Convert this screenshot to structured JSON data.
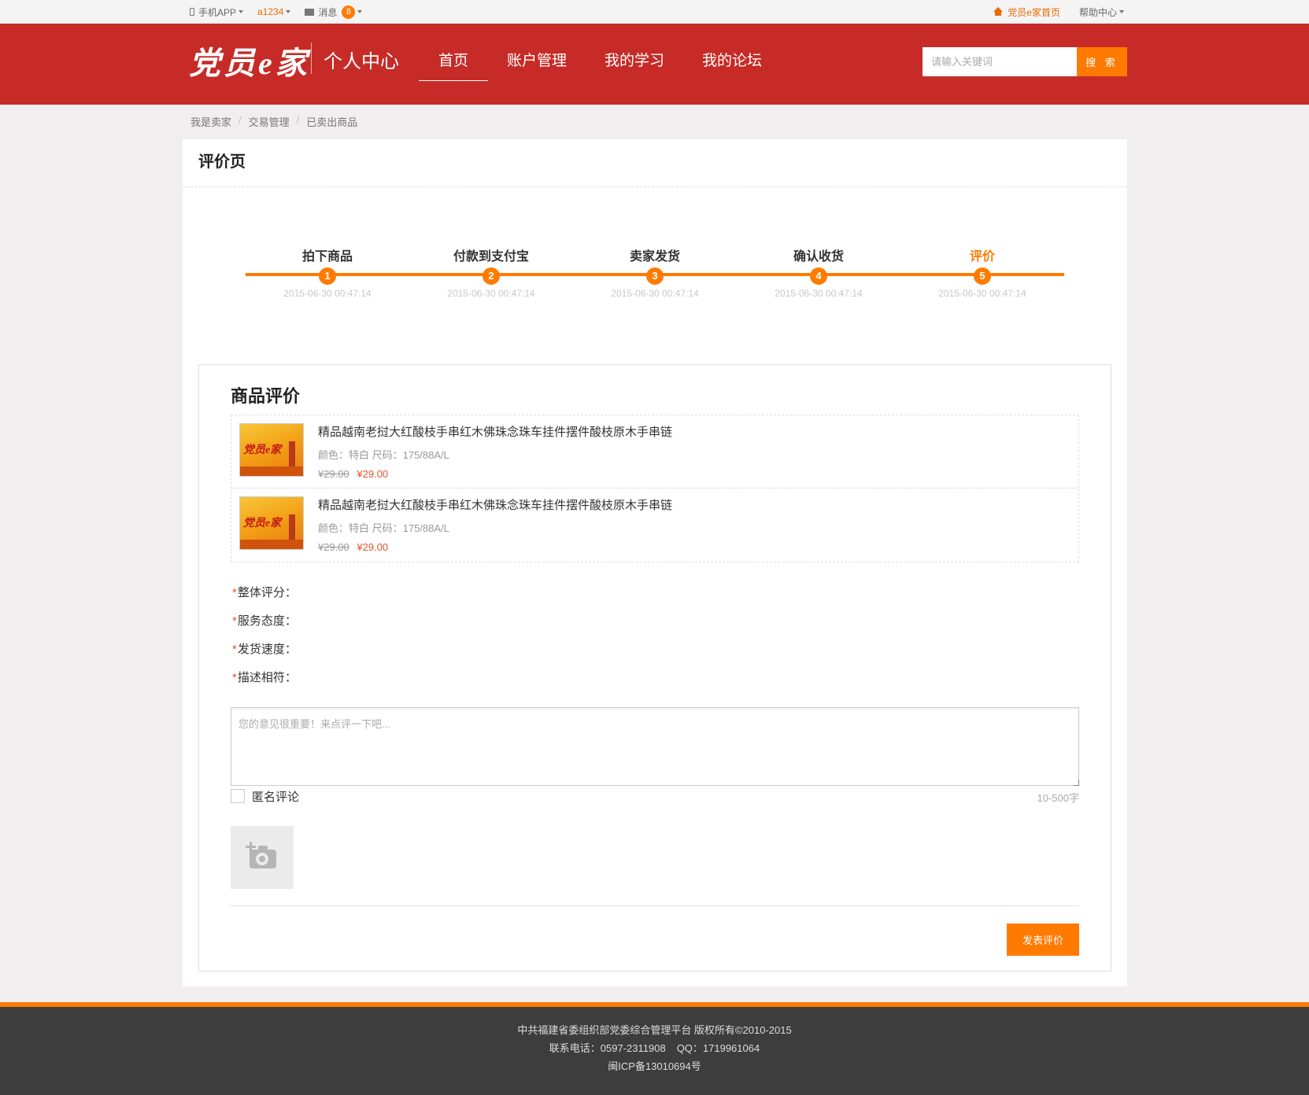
{
  "topbar": {
    "app_label": "手机APP",
    "username": "a1234",
    "messages_label": "消息",
    "messages_count": "8",
    "home_link": "党员e家首页",
    "help_label": "帮助中心"
  },
  "header": {
    "logo_text": "党员e家",
    "logo_sub": "个人中心",
    "nav": [
      "首页",
      "账户管理",
      "我的学习",
      "我的论坛"
    ],
    "search_placeholder": "请输入关键词",
    "search_button": "搜 索"
  },
  "breadcrumb": [
    "我是卖家",
    "交易管理",
    "已卖出商品"
  ],
  "page_title": "评价页",
  "steps": [
    {
      "label": "拍下商品",
      "num": "1",
      "time": "2015-06-30 00:47:14"
    },
    {
      "label": "付款到支付宝",
      "num": "2",
      "time": "2015-06-30 00:47:14"
    },
    {
      "label": "卖家发货",
      "num": "3",
      "time": "2015-06-30 00:47:14"
    },
    {
      "label": "确认收货",
      "num": "4",
      "time": "2015-06-30 00:47:14"
    },
    {
      "label": "评价",
      "num": "5",
      "time": "2015-06-30 00:47:14"
    }
  ],
  "eval": {
    "title": "商品评价",
    "goods": [
      {
        "thumb_text": "党员e家",
        "name": "精品越南老挝大红酸枝手串红木佛珠念珠车挂件摆件酸枝原木手串链",
        "spec": "颜色：特白 尺码：175/88A/L",
        "old_price": "¥29.00",
        "price": "¥29.00"
      },
      {
        "thumb_text": "党员e家",
        "name": "精品越南老挝大红酸枝手串红木佛珠念珠车挂件摆件酸枝原木手串链",
        "spec": "颜色：特白 尺码：175/88A/L",
        "old_price": "¥29.00",
        "price": "¥29.00"
      }
    ],
    "required_mark": "*",
    "ratings": [
      "整体评分：",
      "服务态度：",
      "发货速度：",
      "描述相符："
    ],
    "comment_placeholder": "您的意见很重要！来点评一下吧...",
    "count_hint": "10-500字",
    "anonymous_label": "匿名评论",
    "submit_label": "发表评价"
  },
  "footer": {
    "line1": "中共福建省委组织部党委综合管理平台 版权所有©2010-2015",
    "phone": "联系电话：0597-2311908",
    "qq": "QQ：1719961064",
    "icp": "闽ICP备13010694号"
  },
  "colors": {
    "header_red": "#c62b27",
    "accent_orange": "#ff7a00",
    "price_red": "#e4532d",
    "footer_bg": "#3d3d3d"
  },
  "icons": [
    "phone-icon",
    "mail-icon",
    "home-icon",
    "camera-icon",
    "chevron-down-icon"
  ]
}
